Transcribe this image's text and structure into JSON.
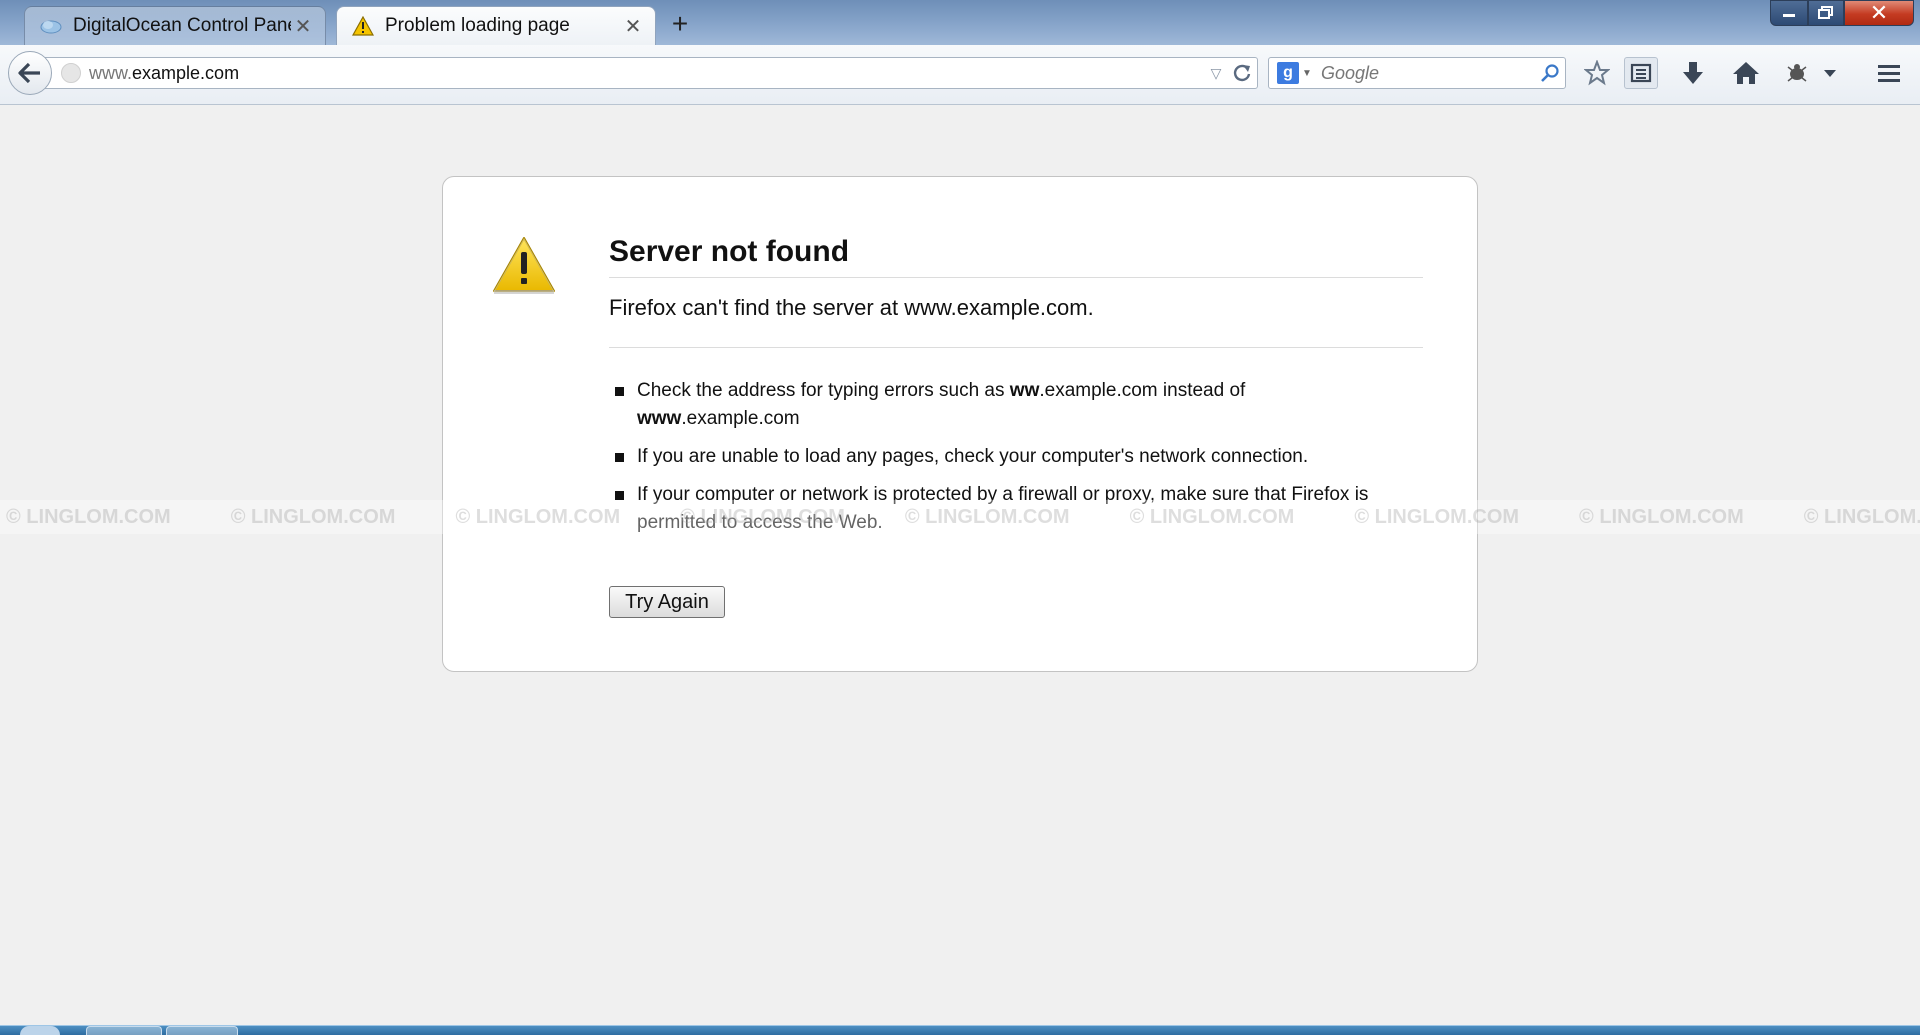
{
  "tabs": [
    {
      "label": "DigitalOcean Control Panel",
      "active": false,
      "icon": "digitalocean-icon"
    },
    {
      "label": "Problem loading page",
      "active": true,
      "icon": "warning-icon"
    }
  ],
  "new_tab_label": "+",
  "close_glyph": "✕",
  "window": {
    "minimize": "▬",
    "maximize": "❐",
    "close": "✕"
  },
  "navbar": {
    "url_prefix": "www.",
    "url_host": "example.com",
    "search_engine_letter": "g",
    "search_placeholder": "Google"
  },
  "error": {
    "title": "Server not found",
    "description": "Firefox can't find the server at www.example.com.",
    "items": [
      {
        "parts": [
          {
            "text": "Check the address for typing errors such as ",
            "bold": false
          },
          {
            "text": "ww",
            "bold": true
          },
          {
            "text": ".example.com instead of ",
            "bold": false
          },
          {
            "text": "www",
            "bold": true
          },
          {
            "text": ".example.com",
            "bold": false
          }
        ]
      },
      {
        "parts": [
          {
            "text": "If you are unable to load any pages, check your computer's network connection.",
            "bold": false
          }
        ]
      },
      {
        "parts": [
          {
            "text": "If your computer or network is protected by a firewall or proxy, make sure that Firefox is permitted to access the Web.",
            "bold": false
          }
        ]
      }
    ],
    "try_again_label": "Try Again"
  },
  "watermark": "© LINGLOM.COM",
  "colors": {
    "accent": "#3c7be0",
    "close_red": "#c43b22",
    "warning_yellow": "#f5c400"
  }
}
